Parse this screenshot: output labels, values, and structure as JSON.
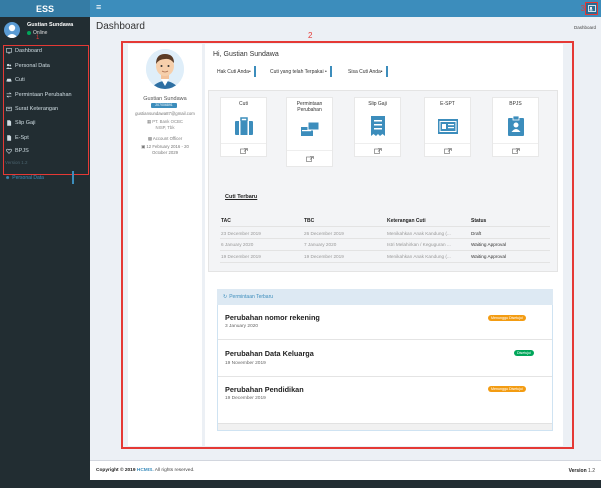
{
  "app": {
    "logo": "ESS"
  },
  "header": {
    "annotation": "3"
  },
  "user": {
    "name": "Gustian Sundawa",
    "status": "Online"
  },
  "sidebar": {
    "annotation": "1",
    "items": [
      {
        "label": "Dashboard",
        "icon": "monitor-icon"
      },
      {
        "label": "Personal Data",
        "icon": "users-icon"
      },
      {
        "label": "Cuti",
        "icon": "car-icon"
      },
      {
        "label": "Permintaan Perubahan",
        "icon": "exchange-icon"
      },
      {
        "label": "Surat Keterangan",
        "icon": "document-icon"
      },
      {
        "label": "Slip Gaji",
        "icon": "file-icon"
      },
      {
        "label": "E-Spt",
        "icon": "file-icon"
      },
      {
        "label": "BPJS",
        "icon": "heart-icon"
      }
    ],
    "version": "Version 1.2"
  },
  "page": {
    "title": "Dashboard",
    "breadcrumb": "Dashboard",
    "annotation": "2"
  },
  "profile": {
    "name": "Gustian Sundawa",
    "nik": "207006891",
    "email": "gustiansundawa87@gmail.com",
    "company": "PT. Bank OCBC NISP, Tbk",
    "position": "Account Officer",
    "join_date": "12 February 2016 - 20 October 2029",
    "active_tab": "Personal Data"
  },
  "greeting": "Hi, Gustian Sundawa",
  "tabs": [
    "Hak Cuti Anda•",
    "Cuti yang telah Terpakai •",
    "Sisa Cuti Anda•"
  ],
  "quick_links": [
    {
      "label": "Cuti",
      "icon": "briefcase-icon"
    },
    {
      "label": "Permintaan Perubahan",
      "icon": "transfer-icon"
    },
    {
      "label": "Slip Gaji",
      "icon": "receipt-icon"
    },
    {
      "label": "E-SPT",
      "icon": "id-card-icon"
    },
    {
      "label": "BPJS",
      "icon": "badge-icon"
    }
  ],
  "cuti_terbaru": {
    "title": "Cuti Terbaru",
    "columns": [
      "TAC",
      "TBC",
      "Keterangan Cuti",
      "Status"
    ],
    "rows": [
      [
        "23 December 2019",
        "26 December 2019",
        "Menikahkan Anak Kandung (...",
        "Draft"
      ],
      [
        "6 January 2020",
        "7 January 2020",
        "Istri Melahirkan / Keguguran ...",
        "Waiting Approval"
      ],
      [
        "19 December 2019",
        "19 December 2019",
        "Menikahkan Anak Kandung (...",
        "Waiting Approval"
      ]
    ]
  },
  "permintaan": {
    "title": "Permintaan Terbaru",
    "items": [
      {
        "title": "Perubahan nomor rekening",
        "date": "3 January 2020",
        "status": "Menunggu Disetujui",
        "color": "#f39c12"
      },
      {
        "title": "Perubahan Data Keluarga",
        "date": "19 November 2019",
        "status": "Disetujui",
        "color": "#00a65a"
      },
      {
        "title": "Perubahan Pendidikan",
        "date": "19 December 2019",
        "status": "Menunggu Disetujui",
        "color": "#f39c12"
      }
    ]
  },
  "footer": {
    "copyright_prefix": "Copyright © 2019",
    "brand": "HCMIS.",
    "copyright_suffix": "All rights reserved.",
    "version_label": "Version",
    "version": "1.2"
  }
}
